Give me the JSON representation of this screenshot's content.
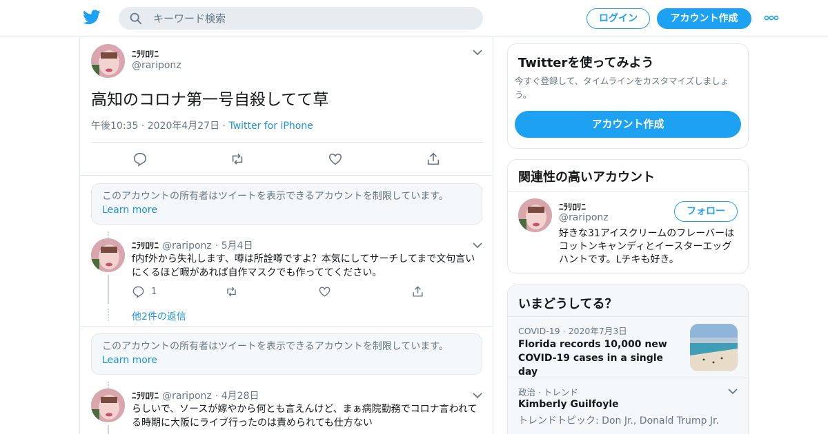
{
  "nav": {
    "search_placeholder": "キーワード検索",
    "login_label": "ログイン",
    "signup_label": "アカウント作成"
  },
  "main_tweet": {
    "display_name": "ﾆﾗﾘﾛﾘﾆ",
    "handle": "@rariponz",
    "text": "高知のコロナ第一号自殺してて草",
    "time": "午後10:35",
    "date": "2020年4月27日",
    "source": "Twitter for iPhone"
  },
  "notice_1": {
    "text": "このアカウントの所有者はツイートを表示できるアカウントを制限しています。",
    "link": "Learn more"
  },
  "reply_1": {
    "display_name": "ﾆﾗﾘﾛﾘﾆ",
    "handle": "@rariponz",
    "date": "5月4日",
    "text": "f内f外から失礼します、噂は所詮噂ですよ？本気にしてサーチしてまで文句言いにくるほど暇があれば自作マスクでも作っててください。",
    "reply_count": "1",
    "more_replies": "他2件の返信"
  },
  "notice_2": {
    "text": "このアカウントの所有者はツイートを表示できるアカウントを制限しています。",
    "link": "Learn more"
  },
  "reply_2": {
    "display_name": "ﾆﾗﾘﾛﾘﾆ",
    "handle": "@rariponz",
    "date": "4月28日",
    "text": "らしいで、ソースが嫁やから何とも言えんけど、まぁ病院勤務でコロナ言われてる時期に大阪にライブ行ったのは責められても仕方ない"
  },
  "signup_card": {
    "title": "Twitterを使ってみよう",
    "desc": "今すぐ登録して、タイムラインをカスタマイズしましょう。",
    "button": "アカウント作成"
  },
  "related_card": {
    "title": "関連性の高いアカウント",
    "display_name": "ﾆﾗﾘﾛﾘﾆ",
    "handle": "@rariponz",
    "follow_label": "フォロー",
    "bio": "好きな31アイスクリームのフレーバーはコットンキャンディとイースターエッグハントです。Lチキも好き。"
  },
  "trends_card": {
    "title": "いまどうしてる？",
    "items": [
      {
        "context": "COVID-19",
        "date": "2020年7月3日",
        "headline": "Florida records 10,000 new COVID-19 cases in a single day"
      },
      {
        "context": "政治 · トレンド",
        "headline": "Kimberly Guilfoyle",
        "topics": "トレンドトピック: Don Jr., Donald Trump Jr."
      }
    ]
  },
  "colors": {
    "brand": "#1da1f2",
    "link": "#1b95e0",
    "muted": "#657786",
    "border": "#e1e8ed"
  },
  "icons": [
    "twitter-bird-icon",
    "search-icon",
    "more-icon",
    "chevron-down-icon",
    "reply-icon",
    "retweet-icon",
    "like-icon",
    "share-icon"
  ]
}
